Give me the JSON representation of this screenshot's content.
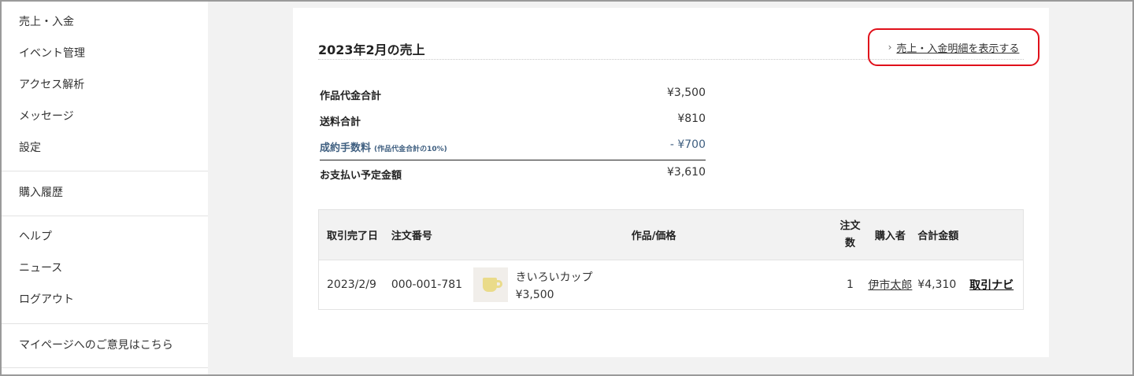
{
  "sidebar": {
    "group1": [
      "売上・入金",
      "イベント管理",
      "アクセス解析",
      "メッセージ",
      "設定"
    ],
    "group2": [
      "購入履歴"
    ],
    "group3": [
      "ヘルプ",
      "ニュース",
      "ログアウト"
    ],
    "group4": [
      "マイページへのご意見はこちら"
    ]
  },
  "sales": {
    "title": "2023年2月の売上",
    "detail_link": "売上・入金明細を表示する",
    "detail_link_chevron": "›",
    "summary": {
      "item_total_label": "作品代金合計",
      "item_total_value": "¥3,500",
      "shipping_label": "送料合計",
      "shipping_value": "¥810",
      "fee_label": "成約手数料",
      "fee_note": "(作品代金合計の10%)",
      "fee_value": "- ¥700",
      "payout_label": "お支払い予定金額",
      "payout_value": "¥3,610"
    },
    "table": {
      "headers": {
        "date": "取引完了日",
        "order_no": "注文番号",
        "item_price": "作品/価格",
        "qty": "注文数",
        "buyer": "購入者",
        "total": "合計金額"
      },
      "rows": [
        {
          "date": "2023/2/9",
          "order_no": "000-001-781",
          "item_name": "きいろいカップ",
          "item_price": "¥3,500",
          "qty": "1",
          "buyer": "伊市太郎",
          "total": "¥4,310",
          "action": "取引ナビ"
        }
      ]
    }
  },
  "colors": {
    "highlight_border": "#e0101a",
    "fee_text": "#3f5f80",
    "page_background": "#f2f2f2"
  }
}
